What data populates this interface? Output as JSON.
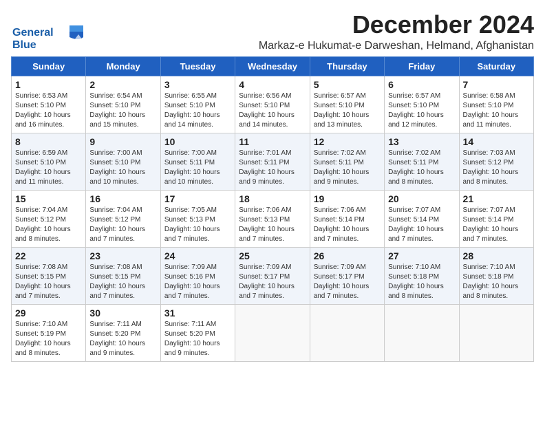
{
  "header": {
    "logo_line1": "General",
    "logo_line2": "Blue",
    "title": "December 2024",
    "subtitle": "Markaz-e Hukumat-e Darweshan, Helmand, Afghanistan"
  },
  "columns": [
    "Sunday",
    "Monday",
    "Tuesday",
    "Wednesday",
    "Thursday",
    "Friday",
    "Saturday"
  ],
  "weeks": [
    [
      {
        "day": "1",
        "info": "Sunrise: 6:53 AM\nSunset: 5:10 PM\nDaylight: 10 hours\nand 16 minutes."
      },
      {
        "day": "2",
        "info": "Sunrise: 6:54 AM\nSunset: 5:10 PM\nDaylight: 10 hours\nand 15 minutes."
      },
      {
        "day": "3",
        "info": "Sunrise: 6:55 AM\nSunset: 5:10 PM\nDaylight: 10 hours\nand 14 minutes."
      },
      {
        "day": "4",
        "info": "Sunrise: 6:56 AM\nSunset: 5:10 PM\nDaylight: 10 hours\nand 14 minutes."
      },
      {
        "day": "5",
        "info": "Sunrise: 6:57 AM\nSunset: 5:10 PM\nDaylight: 10 hours\nand 13 minutes."
      },
      {
        "day": "6",
        "info": "Sunrise: 6:57 AM\nSunset: 5:10 PM\nDaylight: 10 hours\nand 12 minutes."
      },
      {
        "day": "7",
        "info": "Sunrise: 6:58 AM\nSunset: 5:10 PM\nDaylight: 10 hours\nand 11 minutes."
      }
    ],
    [
      {
        "day": "8",
        "info": "Sunrise: 6:59 AM\nSunset: 5:10 PM\nDaylight: 10 hours\nand 11 minutes."
      },
      {
        "day": "9",
        "info": "Sunrise: 7:00 AM\nSunset: 5:10 PM\nDaylight: 10 hours\nand 10 minutes."
      },
      {
        "day": "10",
        "info": "Sunrise: 7:00 AM\nSunset: 5:11 PM\nDaylight: 10 hours\nand 10 minutes."
      },
      {
        "day": "11",
        "info": "Sunrise: 7:01 AM\nSunset: 5:11 PM\nDaylight: 10 hours\nand 9 minutes."
      },
      {
        "day": "12",
        "info": "Sunrise: 7:02 AM\nSunset: 5:11 PM\nDaylight: 10 hours\nand 9 minutes."
      },
      {
        "day": "13",
        "info": "Sunrise: 7:02 AM\nSunset: 5:11 PM\nDaylight: 10 hours\nand 8 minutes."
      },
      {
        "day": "14",
        "info": "Sunrise: 7:03 AM\nSunset: 5:12 PM\nDaylight: 10 hours\nand 8 minutes."
      }
    ],
    [
      {
        "day": "15",
        "info": "Sunrise: 7:04 AM\nSunset: 5:12 PM\nDaylight: 10 hours\nand 8 minutes."
      },
      {
        "day": "16",
        "info": "Sunrise: 7:04 AM\nSunset: 5:12 PM\nDaylight: 10 hours\nand 7 minutes."
      },
      {
        "day": "17",
        "info": "Sunrise: 7:05 AM\nSunset: 5:13 PM\nDaylight: 10 hours\nand 7 minutes."
      },
      {
        "day": "18",
        "info": "Sunrise: 7:06 AM\nSunset: 5:13 PM\nDaylight: 10 hours\nand 7 minutes."
      },
      {
        "day": "19",
        "info": "Sunrise: 7:06 AM\nSunset: 5:14 PM\nDaylight: 10 hours\nand 7 minutes."
      },
      {
        "day": "20",
        "info": "Sunrise: 7:07 AM\nSunset: 5:14 PM\nDaylight: 10 hours\nand 7 minutes."
      },
      {
        "day": "21",
        "info": "Sunrise: 7:07 AM\nSunset: 5:14 PM\nDaylight: 10 hours\nand 7 minutes."
      }
    ],
    [
      {
        "day": "22",
        "info": "Sunrise: 7:08 AM\nSunset: 5:15 PM\nDaylight: 10 hours\nand 7 minutes."
      },
      {
        "day": "23",
        "info": "Sunrise: 7:08 AM\nSunset: 5:15 PM\nDaylight: 10 hours\nand 7 minutes."
      },
      {
        "day": "24",
        "info": "Sunrise: 7:09 AM\nSunset: 5:16 PM\nDaylight: 10 hours\nand 7 minutes."
      },
      {
        "day": "25",
        "info": "Sunrise: 7:09 AM\nSunset: 5:17 PM\nDaylight: 10 hours\nand 7 minutes."
      },
      {
        "day": "26",
        "info": "Sunrise: 7:09 AM\nSunset: 5:17 PM\nDaylight: 10 hours\nand 7 minutes."
      },
      {
        "day": "27",
        "info": "Sunrise: 7:10 AM\nSunset: 5:18 PM\nDaylight: 10 hours\nand 8 minutes."
      },
      {
        "day": "28",
        "info": "Sunrise: 7:10 AM\nSunset: 5:18 PM\nDaylight: 10 hours\nand 8 minutes."
      }
    ],
    [
      {
        "day": "29",
        "info": "Sunrise: 7:10 AM\nSunset: 5:19 PM\nDaylight: 10 hours\nand 8 minutes."
      },
      {
        "day": "30",
        "info": "Sunrise: 7:11 AM\nSunset: 5:20 PM\nDaylight: 10 hours\nand 9 minutes."
      },
      {
        "day": "31",
        "info": "Sunrise: 7:11 AM\nSunset: 5:20 PM\nDaylight: 10 hours\nand 9 minutes."
      },
      null,
      null,
      null,
      null
    ]
  ]
}
